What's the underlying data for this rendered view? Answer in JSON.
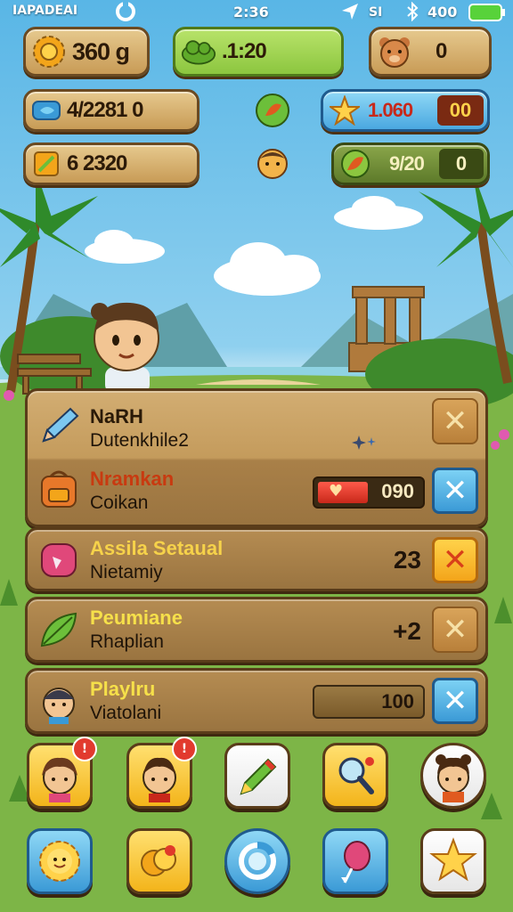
{
  "status_bar": {
    "carrier": "IAPADEAI",
    "time": "2:36",
    "signal_text": "SI",
    "battery_level": "400"
  },
  "resources": {
    "gold": "360 g",
    "energy": ".1:20",
    "bear_count": "0",
    "fish_progress": "4/2281 0",
    "star_value": "1.060",
    "star_bonus": "00",
    "ticket_progress": "6 2320",
    "leaf_value": "9/20",
    "leaf_bonus": "0"
  },
  "rows": [
    {
      "title": "NaRH",
      "subtitle": "Dutenkhile2",
      "title_color": "#2a1a08"
    },
    {
      "title": "Nramkan",
      "subtitle": "Coikan",
      "title_color": "#c83a10",
      "bar_value": "090"
    },
    {
      "title": "Assila Setaual",
      "subtitle": "Nietamiy",
      "title_color": "#f6d24a",
      "value": "23"
    },
    {
      "title": "Peumiane",
      "subtitle": "Rhaplian",
      "title_color": "#f6e04a",
      "value": "+2"
    },
    {
      "title": "Playlru",
      "subtitle": "Viatolani",
      "title_color": "#f6e04a",
      "bar_value": "100"
    }
  ],
  "icons": {
    "gold": "gear-coin-icon",
    "energy": "green-cloud-icon",
    "bear": "bear-face-icon",
    "fish": "fish-icon",
    "star": "star-icon",
    "ticket": "ticket-icon",
    "leaf": "leaf-icon"
  },
  "colors": {
    "panel": "#a98048",
    "accent_blue": "#3b9ad6",
    "accent_orange": "#f3a51a",
    "energy_green": "#8cc63f"
  }
}
